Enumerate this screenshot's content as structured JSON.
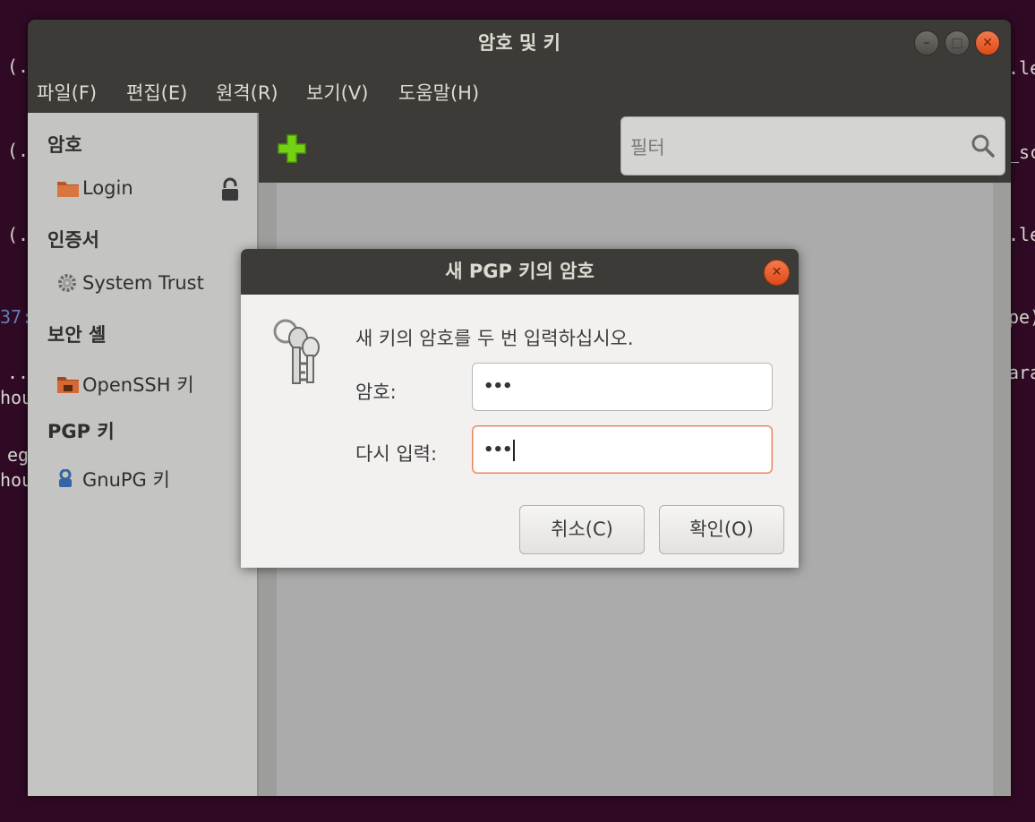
{
  "terminal_fragments": [
    "(.",
    "(.",
    "(.",
    "37:",
    "..",
    "hou",
    "eg",
    "hou",
    ".le",
    "_sc",
    ".le",
    "pe)",
    "ara"
  ],
  "window": {
    "title": "암호 및 키",
    "menu": [
      "파일(F)",
      "편집(E)",
      "원격(R)",
      "보기(V)",
      "도움말(H)"
    ]
  },
  "sidebar": {
    "sections": [
      {
        "heading": "암호",
        "items": [
          {
            "label": "Login",
            "icon": "folder-icon",
            "locked": true
          }
        ]
      },
      {
        "heading": "인증서",
        "items": [
          {
            "label": "System Trust",
            "icon": "gear-icon"
          }
        ]
      },
      {
        "heading": "보안 셸",
        "items": [
          {
            "label": "OpenSSH 키",
            "icon": "ssh-folder-icon"
          }
        ]
      },
      {
        "heading": "PGP 키",
        "items": [
          {
            "label": "GnuPG 키",
            "icon": "person-key-icon"
          }
        ]
      }
    ]
  },
  "toolbar": {
    "add_icon": "plus-icon",
    "filter_placeholder": "필터",
    "search_icon": "search-icon"
  },
  "dialog": {
    "title": "새 PGP 키의 암호",
    "message": "새 키의 암호를 두 번 입력하십시오.",
    "password_label": "암호:",
    "password_value": "•••",
    "confirm_label": "다시 입력:",
    "confirm_value": "•••",
    "cancel_label": "취소(C)",
    "ok_label": "확인(O)"
  },
  "colors": {
    "desktop": "#300a24",
    "titlebar": "#3c3b37",
    "close_button": "#df4a16",
    "add_icon": "#73d216"
  }
}
